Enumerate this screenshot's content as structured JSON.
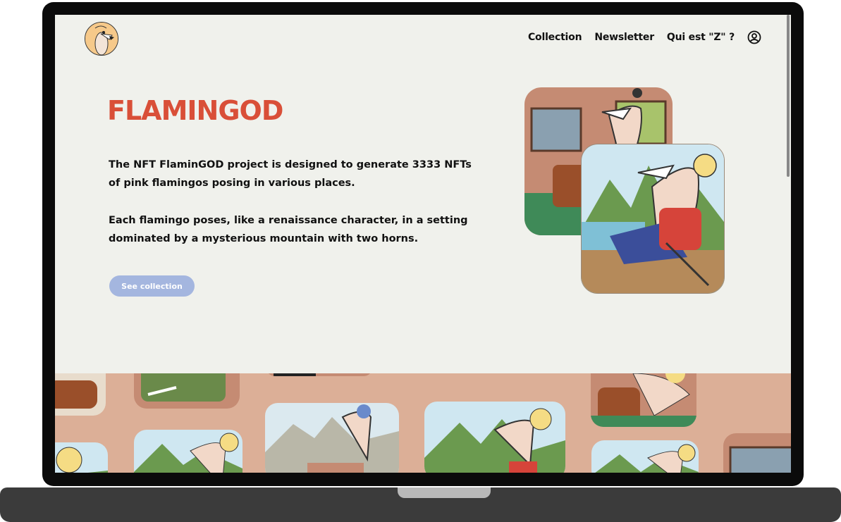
{
  "nav": {
    "items": [
      "Collection",
      "Newsletter",
      "Qui est \"Z\" ?"
    ],
    "user_icon": "user-circle-icon"
  },
  "hero": {
    "brand": "FLAMINGOD",
    "paragraph1": "The NFT FlaminGOD project is designed to generate 3333 NFTs of pink flamingos posing in various places.",
    "paragraph2": "Each flamingo poses, like a renaissance character, in a setting dominated by a mysterious mountain with two horns.",
    "cta_label": "See collection"
  },
  "colors": {
    "brand": "#d94f38",
    "background": "#f0f1ec",
    "button": "#a4b6df",
    "strip": "#dcaf97"
  }
}
